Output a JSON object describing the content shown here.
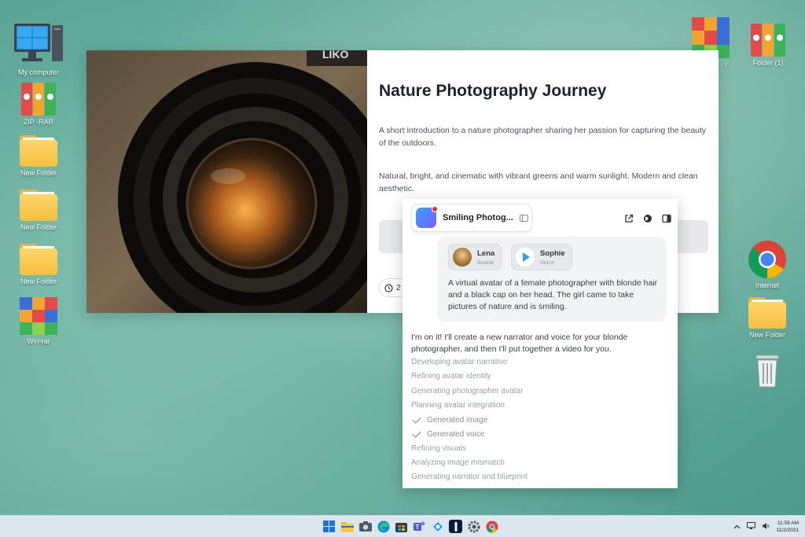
{
  "desktop": {
    "icons_left": [
      {
        "label": "My computer"
      },
      {
        "label": "ZIP -RAR"
      },
      {
        "label": "New Folder"
      },
      {
        "label": "New Folder"
      },
      {
        "label": "New Folder"
      },
      {
        "label": "Win-rar"
      }
    ],
    "icons_right": [
      {
        "label": "r"
      },
      {
        "label": "Folder (1)"
      },
      {
        "label": "Internet"
      },
      {
        "label": "New Folder"
      }
    ]
  },
  "main_window": {
    "photo_text": "LIKO",
    "title": "Nature Photography Journey",
    "description": "A short introduction to a nature photographer sharing her passion for capturing the beauty of the outdoors.",
    "style": "Natural, bright, and cinematic with vibrant greens and warm sunlight. Modern and clean aesthetic.",
    "duration_label": "2"
  },
  "chat": {
    "tab_title": "Smiling Photog...",
    "chips": [
      {
        "name": "Lena",
        "type": "Avatar"
      },
      {
        "name": "Sophie",
        "type": "Voice"
      }
    ],
    "user_message": "A virtual avatar of a female photographer with blonde hair and a black cap on her head. The girl came to take pictures of nature and is smiling.",
    "assistant_reply": "I'm on it! I'll create a new narrator and voice for your blonde photographer, and then I'll put together a video for you.",
    "steps": [
      {
        "text": "Developing avatar narrative",
        "done": false
      },
      {
        "text": "Refining avatar identity",
        "done": false
      },
      {
        "text": "Generating photographer avatar",
        "done": false
      },
      {
        "text": "Planning avatar integration",
        "done": false
      },
      {
        "text": "Generated image",
        "done": true
      },
      {
        "text": "Generated voice",
        "done": true
      },
      {
        "text": "Refining visuals",
        "done": false
      },
      {
        "text": "Analyzing image mismatch",
        "done": false
      },
      {
        "text": "Generating narrator and blueprint",
        "done": false
      }
    ]
  },
  "taskbar": {
    "clock_time": "11:59 AM",
    "clock_date": "11/2/2021"
  },
  "colors": {
    "desktop": "#5fa898",
    "taskbar": "#dce6ef",
    "accent": "#2ea1e8"
  }
}
